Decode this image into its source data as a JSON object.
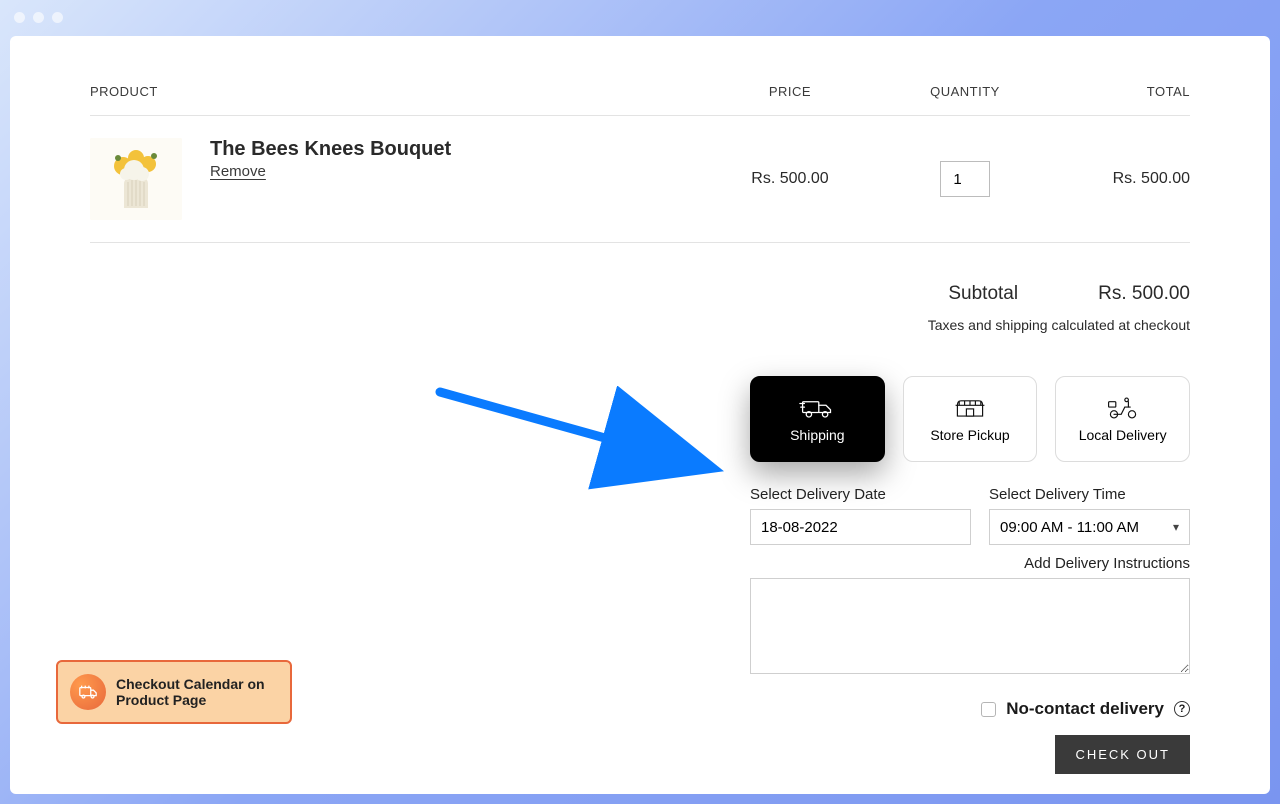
{
  "headers": {
    "product": "PRODUCT",
    "price": "PRICE",
    "quantity": "QUANTITY",
    "total": "TOTAL"
  },
  "item": {
    "title": "The Bees Knees Bouquet",
    "remove": "Remove",
    "price": "Rs. 500.00",
    "qty": "1",
    "line_total": "Rs. 500.00"
  },
  "summary": {
    "subtotal_label": "Subtotal",
    "subtotal_value": "Rs. 500.00",
    "tax_note": "Taxes and shipping calculated at checkout"
  },
  "methods": {
    "shipping": "Shipping",
    "store_pickup": "Store Pickup",
    "local_delivery": "Local Delivery"
  },
  "date": {
    "label": "Select Delivery Date",
    "value": "18-08-2022"
  },
  "time": {
    "label": "Select Delivery Time",
    "value": "09:00 AM - 11:00 AM"
  },
  "instructions_label": "Add Delivery Instructions",
  "nocontact_label": "No-contact delivery",
  "checkout_label": "CHECK OUT",
  "callout": "Checkout Calendar on Product Page"
}
